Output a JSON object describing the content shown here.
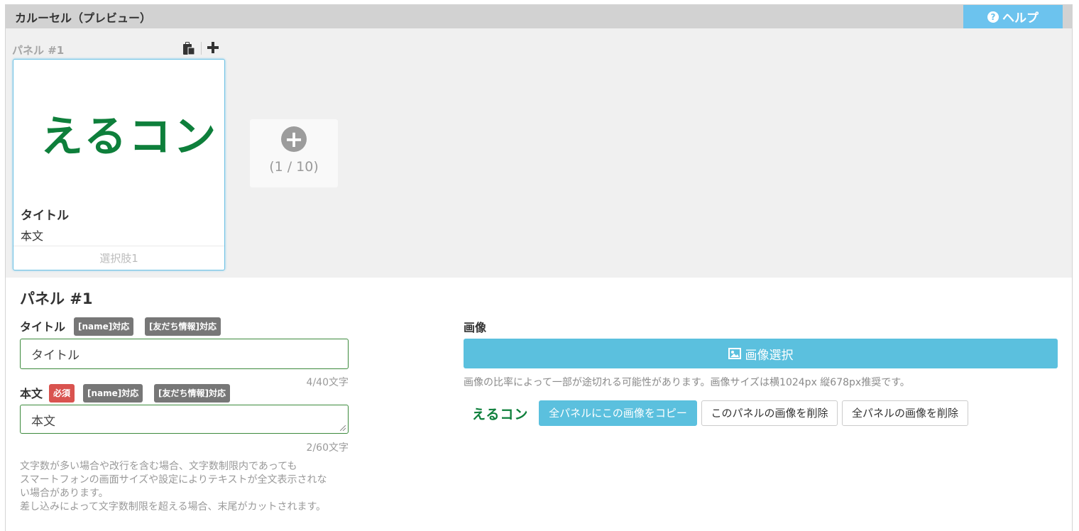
{
  "header": {
    "title": "カルーセル（プレビュー）",
    "help_label": "ヘルプ",
    "help_icon": "question-circle-icon"
  },
  "preview": {
    "panel_caption": "パネル #1",
    "tools": {
      "copy_icon": "clipboard-icon",
      "add_icon": "plus-icon"
    },
    "card": {
      "logo_text": "えるコン",
      "title": "タイトル",
      "body": "本文",
      "choice": "選択肢1"
    },
    "add_panel": {
      "icon": "plus-circle-icon",
      "count": "(1 / 10)"
    }
  },
  "editor": {
    "heading": "パネル #1",
    "title_field": {
      "label": "タイトル",
      "badges": [
        "[name]対応",
        "[友だち情報]対応"
      ],
      "value": "タイトル",
      "counter": "4/40文字"
    },
    "body_field": {
      "label": "本文",
      "required_badge": "必須",
      "badges": [
        "[name]対応",
        "[友だち情報]対応"
      ],
      "value": "本文",
      "counter": "2/60文字"
    },
    "note_lines": [
      "文字数が多い場合や改行を含む場合、文字数制限内であっても",
      "スマートフォンの画面サイズや設定によりテキストが全文表示されな",
      "い場合があります。",
      "差し込みによって文字数制限を超える場合、末尾がカットされます。"
    ],
    "image": {
      "label": "画像",
      "select_button": "画像選択",
      "select_icon": "image-icon",
      "note": "画像の比率によって一部が途切れる可能性があります。画像サイズは横1024px 縦678px推奨です。",
      "thumb_text": "えるコン",
      "copy_all_button": "全パネルにこの画像をコピー",
      "delete_this_button": "このパネルの画像を削除",
      "delete_all_button": "全パネルの画像を削除"
    }
  },
  "colors": {
    "accent": "#5bc0de",
    "help": "#6cc3ee",
    "logo_green": "#0e7f3b",
    "required": "#d9534f"
  }
}
